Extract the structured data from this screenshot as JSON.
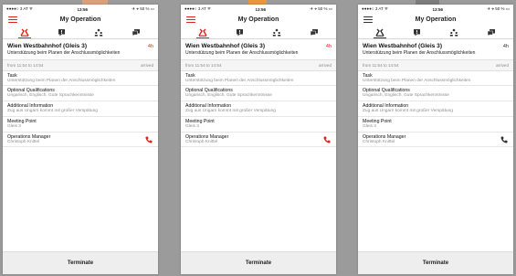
{
  "accent_red": "#e2231a",
  "screens": [
    {
      "variant": "red",
      "status": {
        "carrier": "●●●●○ 3 AT ᯤ",
        "time": "13:56",
        "battery": "✈ ⌖ 50 % ▭"
      },
      "nav_title": "My Operation",
      "tabs": [
        "tools-icon",
        "alert-icon",
        "people-icon",
        "chat-icon"
      ],
      "header": {
        "title": "Wien Westbahnhof (Gleis 3)",
        "duration": "4h",
        "subtitle": "Unterstützung beim Planen der Anschlussmöglichkeiten"
      },
      "time": {
        "range": "from 11:54 to 14:54",
        "state": "arrived"
      },
      "sections": [
        {
          "label": "Task",
          "value": "Unterstützung beim Planen der Anschlussmöglichkeiten"
        },
        {
          "label": "Optional Qualifications",
          "value": "Ungarisch, Englisch, Gute Sprachkenntnisse"
        },
        {
          "label": "Additional Information",
          "value": "Zug aus Ungarn kommt mit großer Verspätung"
        },
        {
          "label": "Meeting Point",
          "value": "Gleis 3"
        },
        {
          "label": "Operations Manager",
          "value": "Christoph Knittel"
        }
      ],
      "footer_button": "Terminate"
    },
    {
      "variant": "red",
      "status": {
        "carrier": "●●●●○ 3 AT ᯤ",
        "time": "13:56",
        "battery": "✈ ⌖ 50 % ▭"
      },
      "nav_title": "My Operation",
      "tabs": [
        "tools-icon",
        "alert-icon",
        "people-icon",
        "chat-icon"
      ],
      "header": {
        "title": "Wien Westbahnhof (Gleis 3)",
        "duration": "4h",
        "subtitle": "Unterstützung beim Planen der Anschlussmöglichkeiten"
      },
      "time": {
        "range": "from 11:54 to 14:54",
        "state": "arrived"
      },
      "sections": [
        {
          "label": "Task",
          "value": "Unterstützung beim Planen der Anschlussmöglichkeiten"
        },
        {
          "label": "Optional Qualifications",
          "value": "Ungarisch, Englisch, Gute Sprachkenntnisse"
        },
        {
          "label": "Additional Information",
          "value": "Zug aus Ungarn kommt mit großer Verspätung"
        },
        {
          "label": "Meeting Point",
          "value": "Gleis 3"
        },
        {
          "label": "Operations Manager",
          "value": "Christoph Knittel"
        }
      ],
      "footer_button": "Terminate"
    },
    {
      "variant": "dark",
      "status": {
        "carrier": "●●●●○ 3 AT ᯤ",
        "time": "13:56",
        "battery": "✈ ⌖ 50 % ▭"
      },
      "nav_title": "My Operation",
      "tabs": [
        "tools-icon",
        "alert-icon",
        "people-icon",
        "chat-icon"
      ],
      "header": {
        "title": "Wien Westbahnhof (Gleis 3)",
        "duration": "4h",
        "subtitle": "Unterstützung beim Planen der Anschlussmöglichkeiten"
      },
      "time": {
        "range": "from 11:54 to 14:54",
        "state": "arrived"
      },
      "sections": [
        {
          "label": "Task",
          "value": "Unterstützung beim Planen der Anschlussmöglichkeiten"
        },
        {
          "label": "Optional Qualifications",
          "value": "Ungarisch, Englisch, Gute Sprachkenntnisse"
        },
        {
          "label": "Additional Information",
          "value": "Zug aus Ungarn kommt mit großer Verspätung"
        },
        {
          "label": "Meeting Point",
          "value": "Gleis 3"
        },
        {
          "label": "Operations Manager",
          "value": "Christoph Knittel"
        }
      ],
      "footer_button": "Terminate"
    }
  ]
}
